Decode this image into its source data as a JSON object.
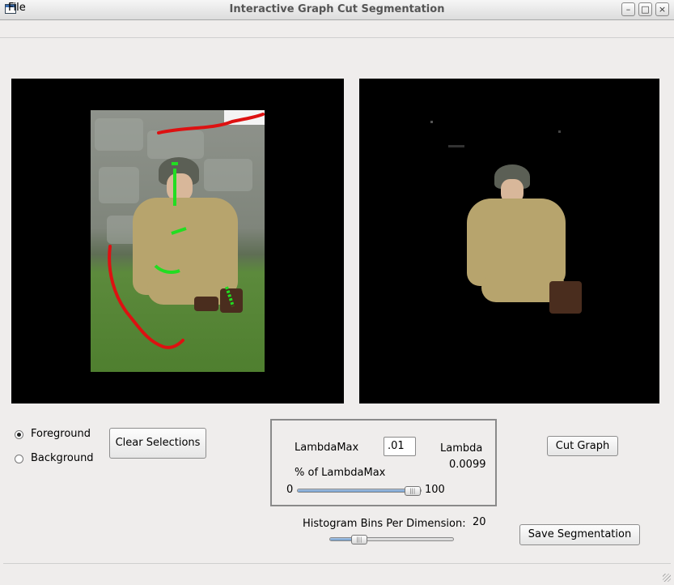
{
  "window": {
    "title": "Interactive Graph Cut Segmentation"
  },
  "menu": {
    "file_label": "File"
  },
  "modes": {
    "foreground_label": "Foreground",
    "background_label": "Background",
    "selected": "Foreground"
  },
  "buttons": {
    "clear_selections": "Clear Selections",
    "cut_graph": "Cut Graph",
    "save_segmentation": "Save Segmentation"
  },
  "lambda_panel": {
    "lambdamax_label": "LambdaMax",
    "lambdamax_value": ".01",
    "lambda_label": "Lambda",
    "lambda_value": "0.0099",
    "percent_label": "% of LambdaMax",
    "slider_min_label": "0",
    "slider_max_label": "100",
    "slider_value_fraction": 0.99
  },
  "histogram": {
    "label": "Histogram Bins Per Dimension:",
    "value": "20",
    "slider_value_fraction": 0.2
  },
  "colors": {
    "foreground_stroke": "#22dd22",
    "background_stroke": "#dd1111",
    "slider_fill": "#6f9ccc"
  }
}
